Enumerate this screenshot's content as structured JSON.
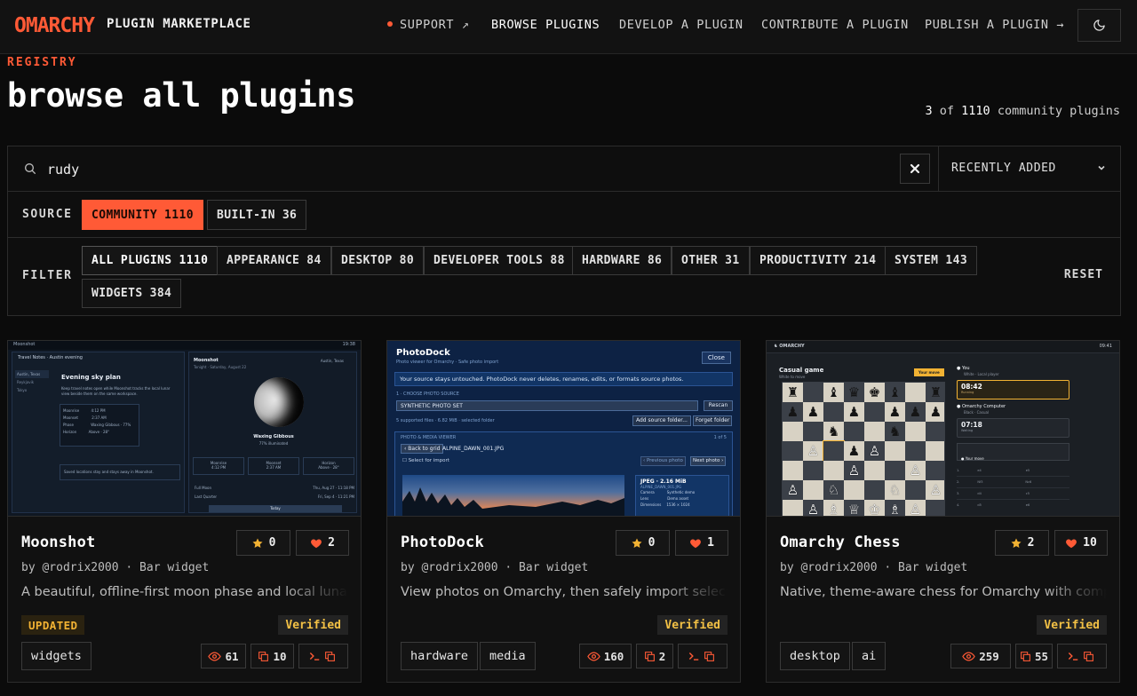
{
  "nav": {
    "logo": "OMARCHY",
    "brand_title": "PLUGIN MARKETPLACE",
    "links": {
      "support": "SUPPORT ↗",
      "browse": "BROWSE PLUGINS",
      "develop": "DEVELOP A PLUGIN",
      "contribute": "CONTRIBUTE A PLUGIN",
      "publish": "PUBLISH A PLUGIN →"
    },
    "theme_icon": "moon-icon"
  },
  "header": {
    "eyebrow": "REGISTRY",
    "title": "browse all plugins",
    "count_shown": "3",
    "count_total": "1110",
    "count_prefix": " of ",
    "count_suffix": " community plugins"
  },
  "search": {
    "value": "rudy",
    "sort_label": "RECENTLY ADDED"
  },
  "source": {
    "label": "SOURCE",
    "options": [
      {
        "label": "COMMUNITY",
        "count": "1110",
        "selected": true
      },
      {
        "label": "BUILT-IN",
        "count": "36",
        "selected": false
      }
    ]
  },
  "filter": {
    "label": "FILTER",
    "reset_label": "RESET",
    "categories": [
      {
        "label": "ALL PLUGINS",
        "count": "1110"
      },
      {
        "label": "APPEARANCE",
        "count": "84"
      },
      {
        "label": "DESKTOP",
        "count": "80"
      },
      {
        "label": "DEVELOPER TOOLS",
        "count": "88"
      },
      {
        "label": "HARDWARE",
        "count": "86"
      },
      {
        "label": "OTHER",
        "count": "31"
      },
      {
        "label": "PRODUCTIVITY",
        "count": "214"
      },
      {
        "label": "SYSTEM",
        "count": "143"
      },
      {
        "label": "WIDGETS",
        "count": "384"
      }
    ]
  },
  "cards": [
    {
      "title": "Moonshot",
      "stars": "0",
      "likes": "2",
      "author": "by @rodrix2000 · Bar widget",
      "description": "A beautiful, offline-first moon phase and local lunar ti",
      "updated_badge": "UPDATED",
      "verified_badge": "Verified",
      "tags": [
        "widgets"
      ],
      "views": "61",
      "copies": "10",
      "thumb": {
        "app": "Moonshot",
        "time": "19:38",
        "subtitle": "Travel Notes · Austin evening",
        "sidebar": [
          "Austin, Texas",
          "Reykjavik",
          "Tokyo"
        ],
        "plan_title": "Evening sky plan",
        "plan_text": "Keep travel notes open while Moonshot tracks the local lunar view beside them on the same workspace.",
        "rows": [
          [
            "Moonrise",
            "4:12 PM"
          ],
          [
            "Moonset",
            "2:37 AM"
          ],
          [
            "Phase",
            "Waxing Gibbous · 77%"
          ],
          [
            "Horizon",
            "Above · 28°"
          ]
        ],
        "note": "Saved locations stay and stays away in Moonshot.",
        "panel_title": "Moonshot",
        "panel_date": "Tonight · Saturday, August 22",
        "location": "Austin, Texas",
        "phase": "Waxing Gibbous",
        "illum": "77% illuminated",
        "stats": [
          [
            "Moonrise",
            "4:12 PM"
          ],
          [
            "Moonset",
            "2:37 AM"
          ],
          [
            "Horizon",
            "Above · 28°"
          ]
        ],
        "events": [
          [
            "Full Moon",
            "Thu, Aug 27 · 11:18 PM"
          ],
          [
            "Last Quarter",
            "Fri, Sep 4 · 11:21 PM"
          ]
        ],
        "today": "Today"
      }
    },
    {
      "title": "PhotoDock",
      "stars": "0",
      "likes": "1",
      "author": "by @rodrix2000 · Bar widget",
      "description": "View photos on Omarchy, then safely import selected",
      "verified_badge": "Verified",
      "tags": [
        "hardware",
        "media"
      ],
      "views": "160",
      "copies": "2",
      "thumb": {
        "app": "PhotoDock",
        "subtitle": "Photo viewer for Omarchy · Safe photo import",
        "close": "Close",
        "notice": "Your source stays untouched. PhotoDock never deletes, renames, edits, or formats source photos.",
        "step": "1 · CHOOSE PHOTO SOURCE",
        "source": "SYNTHETIC PHOTO SET",
        "rescan": "Rescan",
        "supported": "5 supported files · 6.82 MiB · selected folder",
        "add_folder": "Add source folder...",
        "forget": "Forget folder",
        "viewer": "PHOTO & MEDIA VIEWER",
        "pager": "1 of 5",
        "back": "‹ Back to grid",
        "filename": "ALPINE_DAWN_001.JPG",
        "select": "Select for import",
        "prev": "‹ Previous photo",
        "next": "Next photo ›",
        "meta_title": "JPEG · 2.16 MiB",
        "meta_file": "ALPINE_DAWN_001.JPG",
        "meta": [
          [
            "Camera",
            "Synthetic demo"
          ],
          [
            "Lens",
            "Demo asset"
          ],
          [
            "Dimensions",
            "1536 × 1024"
          ]
        ]
      }
    },
    {
      "title": "Omarchy Chess",
      "stars": "2",
      "likes": "10",
      "author": "by @rodrix2000 · Bar widget",
      "description": "Native, theme-aware chess for Omarchy with comput",
      "verified_badge": "Verified",
      "tags": [
        "desktop",
        "ai"
      ],
      "views": "259",
      "copies": "55",
      "thumb": {
        "app": "OMARCHY",
        "time": "09:41",
        "mode": "Casual game",
        "turn": "White to move",
        "badge": "Your move",
        "you": "You",
        "you_sub": "White · Local player",
        "clock1": "08:42",
        "clock1_sub": "Running",
        "opp": "Omarchy Computer",
        "opp_sub": "Black · Casual",
        "clock2": "07:18",
        "clock2_sub": "Waiting",
        "hint": "Your move",
        "moves": [
          [
            "1.",
            "e4",
            "e5"
          ],
          [
            "2.",
            "Nf3",
            "Nc6"
          ],
          [
            "3.",
            "d4",
            "c5"
          ],
          [
            "4.",
            "d5",
            "e6"
          ]
        ]
      }
    }
  ]
}
